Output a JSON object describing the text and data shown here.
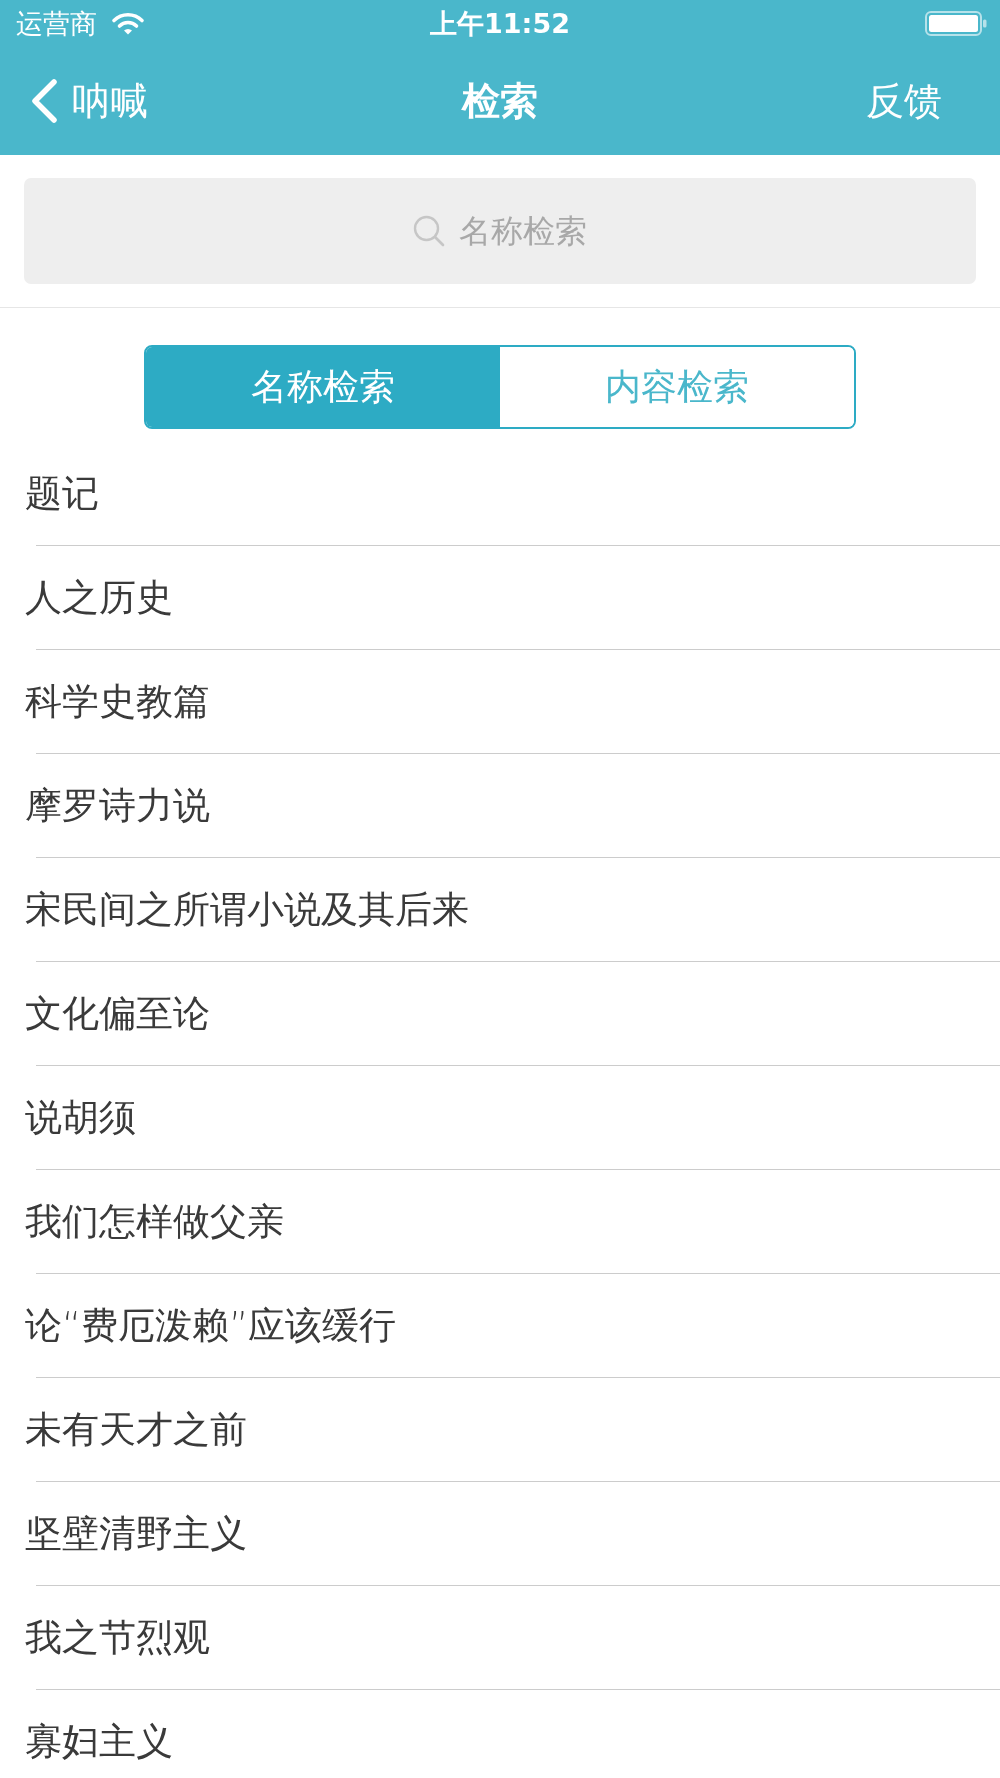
{
  "status_bar": {
    "carrier": "运营商",
    "time": "上午11:52"
  },
  "nav_bar": {
    "back_label": "呐喊",
    "title": "检索",
    "action": "反馈"
  },
  "search": {
    "placeholder": "名称检索"
  },
  "segments": [
    {
      "label": "名称检索",
      "selected": true
    },
    {
      "label": "内容检索",
      "selected": false
    }
  ],
  "items": [
    "题记",
    "人之历史",
    "科学史教篇",
    "摩罗诗力说",
    "宋民间之所谓小说及其后来",
    "文化偏至论",
    "说胡须",
    "我们怎样做父亲",
    "论“费厄泼赖”应该缓行",
    "未有天才之前",
    "坚壁清野主义",
    "我之节烈观",
    "寡妇主义"
  ]
}
